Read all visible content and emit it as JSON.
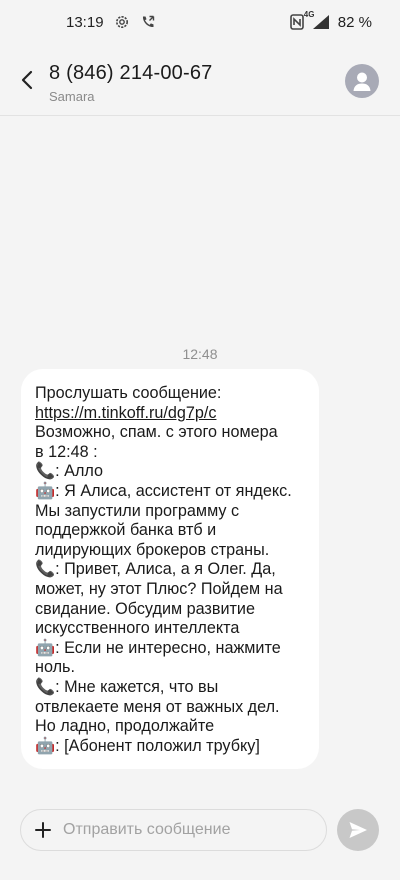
{
  "status_bar": {
    "time": "13:19",
    "battery_percent": "82 %",
    "network": "4G",
    "icons": [
      "gear-icon",
      "call-forward-icon",
      "nfc-icon",
      "signal-icon"
    ]
  },
  "header": {
    "title": "8 (846) 214-00-67",
    "subtitle": "Samara"
  },
  "conversation": {
    "timestamp": "12:48",
    "message_lines": [
      "Прослушать сообщение:",
      "https://m.tinkoff.ru/dg7p/c",
      "Возможно, спам.  с этого номера",
      "в 12:48 :",
      " 📞: Алло",
      "🤖: Я Алиса, ассистент от яндекс.",
      "Мы запустили программу с",
      "поддержкой банка втб и",
      "лидирующих брокеров страны.",
      "📞: Привет, Алиса, а я Олег. Да,",
      "может, ну этот Плюс? Пойдем на",
      "свидание. Обсудим развитие",
      "искусственного интеллекта",
      "🤖: Если не интересно, нажмите",
      "ноль.",
      "📞: Мне кажется, что вы",
      "отвлекаете меня от важных дел.",
      "Но ладно, продолжайте",
      "🤖: [Абонент положил трубку]"
    ]
  },
  "compose": {
    "placeholder": "Отправить сообщение",
    "value": ""
  },
  "colors": {
    "background": "#f4f4f4",
    "bubble": "#ffffff",
    "avatar": "#a8aab6",
    "send_button": "#c8c8c8"
  }
}
